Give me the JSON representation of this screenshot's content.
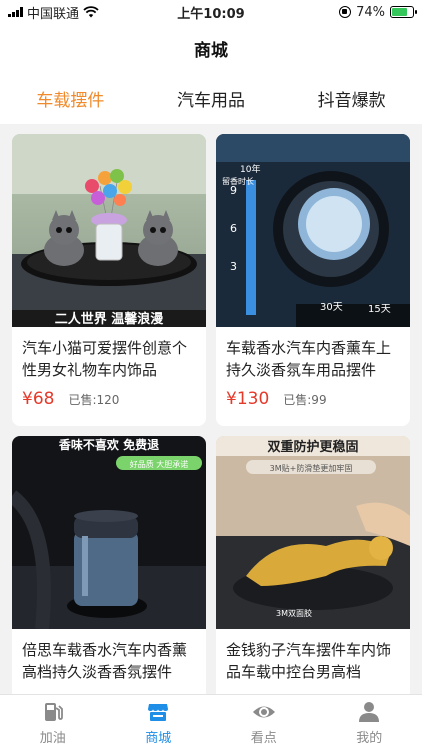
{
  "status_bar": {
    "carrier": "中国联通",
    "time": "上午10:09",
    "battery": "74%",
    "battery_level": 0.74
  },
  "header": {
    "title": "商城"
  },
  "tabs": [
    {
      "label": "车载摆件",
      "active": true
    },
    {
      "label": "汽车用品",
      "active": false
    },
    {
      "label": "抖音爆款",
      "active": false
    }
  ],
  "products": [
    {
      "title": "汽车小猫可爱摆件创意个性男女礼物车内饰品",
      "price": "¥68",
      "sold": "已售:120",
      "image_texts": [
        "二人世界 温馨浪漫"
      ]
    },
    {
      "title": "车载香水汽车内香薰车上持久淡香氛车用品摆件",
      "price": "¥130",
      "sold": "已售:99",
      "image_texts": [
        "留香时长",
        "10年",
        "9",
        "6",
        "3",
        "30天",
        "15天"
      ]
    },
    {
      "title": "倍思车载香水汽车内香薰高档持久淡香香氛摆件",
      "price": "",
      "sold": "",
      "image_texts": [
        "香味不喜欢 免费退",
        "好品质 大胆承诺"
      ]
    },
    {
      "title": "金钱豹子汽车摆件车内饰品车载中控台男高档",
      "price": "",
      "sold": "",
      "image_texts": [
        "双重防护更稳固",
        "3M贴+防滑垫更加牢固",
        "3M双面胶"
      ]
    }
  ],
  "tabbar": [
    {
      "label": "加油",
      "icon": "fuel-pump-icon",
      "active": false
    },
    {
      "label": "商城",
      "icon": "store-icon",
      "active": true
    },
    {
      "label": "看点",
      "icon": "eye-icon",
      "active": false
    },
    {
      "label": "我的",
      "icon": "person-icon",
      "active": false
    }
  ],
  "colors": {
    "tab_active": "#f08a2a",
    "price": "#e5392a",
    "tabbar_active": "#1f8ee6",
    "battery_fill": "#35c759"
  }
}
